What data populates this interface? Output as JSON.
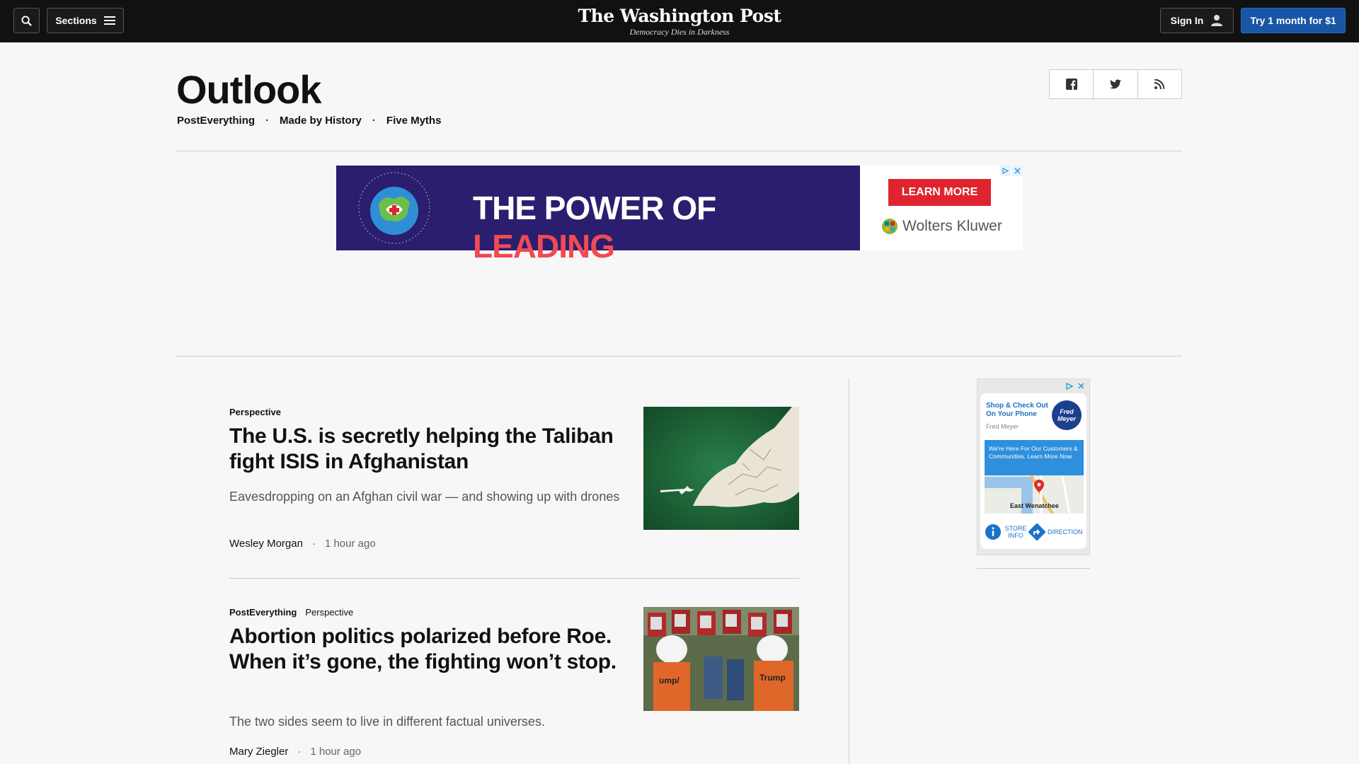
{
  "topbar": {
    "sections_label": "Sections",
    "masthead_logo": "The Washington Post",
    "masthead_tagline": "Democracy Dies in Darkness",
    "signin_label": "Sign In",
    "subscribe_label": "Try 1 month for $1"
  },
  "header": {
    "title": "Outlook",
    "subnav": [
      "PostEverything",
      "Made by History",
      "Five Myths"
    ],
    "separator": "·"
  },
  "top_ad": {
    "headline_main": "THE POWER OF ",
    "headline_accent": "LEADING",
    "cta": "LEARN MORE",
    "brand": "Wolters Kluwer",
    "colors": {
      "background": "#2b1e6e",
      "accent": "#f04a52",
      "cta": "#e0242f"
    }
  },
  "articles": [
    {
      "kicker": [
        "Perspective"
      ],
      "headline": "The U.S. is secretly helping the Taliban fight ISIS in Afghanistan",
      "dek": "Eavesdropping on an Afghan civil war — and showing up with drones",
      "author": "Wesley Morgan",
      "time": "1 hour ago"
    },
    {
      "kicker": [
        "PostEverything",
        "Perspective"
      ],
      "headline": "Abortion politics polarized before Roe. When it’s gone, the fighting won’t stop.",
      "dek": "The two sides seem to live in different factual universes.",
      "author": "Mary Ziegler",
      "time": "1 hour ago"
    }
  ],
  "side_ad": {
    "title": "Shop & Check Out On Your Phone",
    "advertiser": "Fred Meyer",
    "logo": "Fred Meyer",
    "banner": "We're Here For Our Customers & Communities. Learn More Now.",
    "place": "East Wenatchee",
    "action_info": "STORE INFO",
    "action_directions": "DIRECTIONS"
  },
  "colors": {
    "topbar": "#111111",
    "subscribe": "#1955a5",
    "page_bg": "#f7f7f7"
  }
}
